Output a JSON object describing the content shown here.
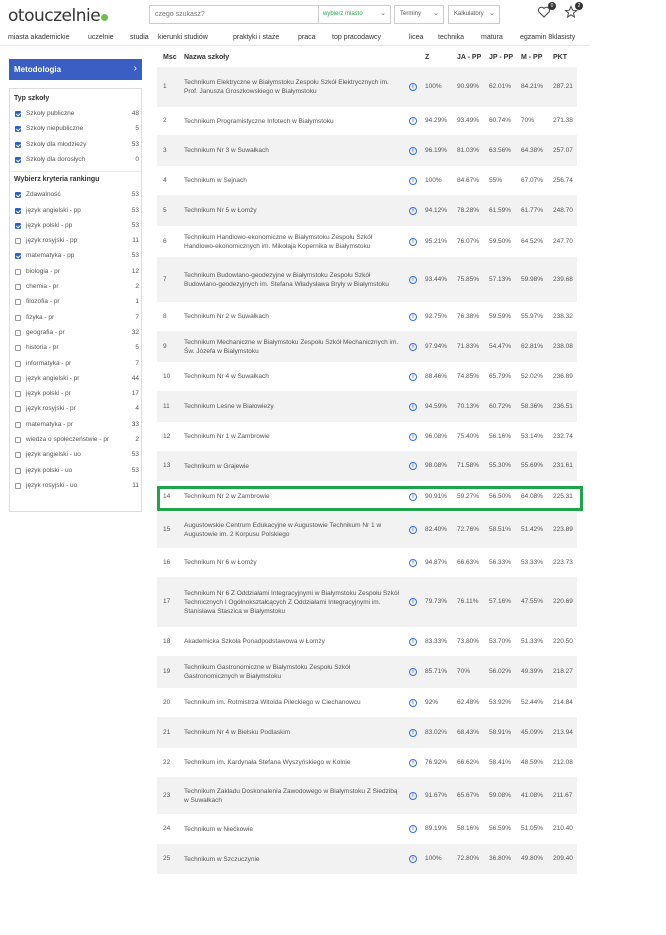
{
  "header": {
    "logo": "otouczelnie",
    "search_placeholder": "czego szukasz?",
    "city_label": "wybierz miasto",
    "terms_label": "Terminy",
    "calculators_label": "Kalkulatory",
    "hearts_count": "0",
    "stars_count": "2"
  },
  "nav": [
    "miasta akademickie",
    "uczelnie",
    "studia",
    "kierunki studiów",
    "praktyki i staże",
    "praca",
    "top pracodawcy",
    "licea",
    "technika",
    "matura",
    "egzamin 8klasisty"
  ],
  "sidebar": {
    "metodologia": "Metodologia",
    "type_title": "Typ szkoły",
    "types": [
      {
        "label": "Szkoły publiczne",
        "count": "48",
        "checked": true
      },
      {
        "label": "Szkoły niepubliczne",
        "count": "5",
        "checked": true
      },
      {
        "label": "Szkoły dla młodzieży",
        "count": "53",
        "checked": true
      },
      {
        "label": "Szkoły dla dorosłych",
        "count": "0",
        "checked": true
      }
    ],
    "criteria_title": "Wybierz kryteria rankingu",
    "criteria": [
      {
        "label": "Zdawalność",
        "count": "53",
        "checked": true
      },
      {
        "label": "język angielski - pp",
        "count": "53",
        "checked": true
      },
      {
        "label": "język polski - pp",
        "count": "53",
        "checked": true
      },
      {
        "label": "język rosyjski - pp",
        "count": "11",
        "checked": false
      },
      {
        "label": "matematyka - pp",
        "count": "53",
        "checked": true
      },
      {
        "label": "biologia - pr",
        "count": "12",
        "checked": false
      },
      {
        "label": "chemia - pr",
        "count": "2",
        "checked": false
      },
      {
        "label": "filozofia - pr",
        "count": "1",
        "checked": false
      },
      {
        "label": "fizyka - pr",
        "count": "7",
        "checked": false
      },
      {
        "label": "geografia - pr",
        "count": "32",
        "checked": false
      },
      {
        "label": "historia - pr",
        "count": "5",
        "checked": false
      },
      {
        "label": "informatyka - pr",
        "count": "7",
        "checked": false
      },
      {
        "label": "język angielski - pr",
        "count": "44",
        "checked": false
      },
      {
        "label": "język polski - pr",
        "count": "17",
        "checked": false
      },
      {
        "label": "język rosyjski - pr",
        "count": "4",
        "checked": false
      },
      {
        "label": "matematyka - pr",
        "count": "33",
        "checked": false
      },
      {
        "label": "wiedza o społeczeństwie - pr",
        "count": "2",
        "checked": false
      },
      {
        "label": "język angielski - uo",
        "count": "53",
        "checked": false
      },
      {
        "label": "język polski - uo",
        "count": "53",
        "checked": false
      },
      {
        "label": "język rosyjski - uo",
        "count": "11",
        "checked": false
      }
    ]
  },
  "table": {
    "headers": {
      "msc": "Msc",
      "name": "Nazwa szkoły",
      "z": "Z",
      "ja": "JA - PP",
      "jp": "JP - PP",
      "m": "M - PP",
      "pkt": "PKT"
    },
    "rows": [
      {
        "msc": "1",
        "name": "Technikum Elektryczne w Białymstoku Zespołu Szkół Elektrycznych im. Prof. Janusza Groszkowskiego w Białymstoku",
        "z": "100%",
        "ja": "90.99%",
        "jp": "62.01%",
        "m": "84.21%",
        "pkt": "287.21"
      },
      {
        "msc": "2",
        "name": "Technikum Programistyczne Infotech w Białymstoku",
        "z": "94.29%",
        "ja": "93.49%",
        "jp": "60.74%",
        "m": "70%",
        "pkt": "271.38"
      },
      {
        "msc": "3",
        "name": "Technikum Nr 3 w Suwałkach",
        "z": "96.19%",
        "ja": "81.03%",
        "jp": "63.56%",
        "m": "64.38%",
        "pkt": "257.07"
      },
      {
        "msc": "4",
        "name": "Technikum w Sejnach",
        "z": "100%",
        "ja": "84.67%",
        "jp": "55%",
        "m": "67.07%",
        "pkt": "256.74"
      },
      {
        "msc": "5",
        "name": "Technikum Nr 5 w Łomży",
        "z": "94.12%",
        "ja": "78.28%",
        "jp": "61.59%",
        "m": "61.77%",
        "pkt": "248.70"
      },
      {
        "msc": "6",
        "name": "Technikum Handlowo-ekonomiczne w Białymstoku Zespołu Szkół Handlowo-ekonomicznych im. Mikołaja Kopernika w Białymstoku",
        "z": "95.21%",
        "ja": "76.07%",
        "jp": "59.50%",
        "m": "64.52%",
        "pkt": "247.70"
      },
      {
        "msc": "7",
        "name": "Technikum Budowlano-geodezyjne w Białymstoku Zespołu Szkół Budowlano-geodezyjnych im. Stefana Władysława Bryły w Białymstoku",
        "z": "93.44%",
        "ja": "75.85%",
        "jp": "57.13%",
        "m": "59.98%",
        "pkt": "239.68"
      },
      {
        "msc": "8",
        "name": "Technikum Nr 2 w Suwałkach",
        "z": "92.75%",
        "ja": "76.38%",
        "jp": "59.59%",
        "m": "55.97%",
        "pkt": "238.32"
      },
      {
        "msc": "9",
        "name": "Technikum Mechaniczne w Białymstoku Zespołu Szkół Mechanicznych im. Św. Józefa w Białymstoku",
        "z": "97.94%",
        "ja": "71.83%",
        "jp": "54.47%",
        "m": "62.81%",
        "pkt": "238.08"
      },
      {
        "msc": "10",
        "name": "Technikum Nr 4 w Suwałkach",
        "z": "88.46%",
        "ja": "74.85%",
        "jp": "65.79%",
        "m": "52.02%",
        "pkt": "236.89"
      },
      {
        "msc": "11",
        "name": "Technikum Leśne w Białowieży",
        "z": "94.59%",
        "ja": "70.13%",
        "jp": "60.72%",
        "m": "58.36%",
        "pkt": "236.51"
      },
      {
        "msc": "12",
        "name": "Technikum Nr 1 w Zambrowie",
        "z": "96.08%",
        "ja": "75.40%",
        "jp": "56.16%",
        "m": "53.14%",
        "pkt": "232.74"
      },
      {
        "msc": "13",
        "name": "Technikum w Grajewie",
        "z": "98.08%",
        "ja": "71.58%",
        "jp": "55.30%",
        "m": "55.69%",
        "pkt": "231.61"
      },
      {
        "msc": "14",
        "name": "Technikum Nr 2 w Zambrowie",
        "z": "90.91%",
        "ja": "59.27%",
        "jp": "56.50%",
        "m": "64.08%",
        "pkt": "225.31"
      },
      {
        "msc": "15",
        "name": "Augustowskie Centrum Edukacyjne w Augustowie Technikum Nr 1 w Augustowie im. 2 Korpusu Polskiego",
        "z": "82.40%",
        "ja": "72.76%",
        "jp": "58.51%",
        "m": "51.42%",
        "pkt": "223.89"
      },
      {
        "msc": "16",
        "name": "Technikum Nr 6 w Łomży",
        "z": "94.87%",
        "ja": "66.63%",
        "jp": "56.33%",
        "m": "53.33%",
        "pkt": "223.73"
      },
      {
        "msc": "17",
        "name": "Technikum Nr 6 Z Oddziałami Integracyjnymi w Białymstoku Zespołu Szkół Technicznych I Ogólnokształcących Z Oddziałami Integracyjnymi im. Stanisława Staszica w Białymstoku",
        "z": "79.73%",
        "ja": "76.11%",
        "jp": "57.16%",
        "m": "47.55%",
        "pkt": "220.69"
      },
      {
        "msc": "18",
        "name": "Akademicka Szkoła Ponadpodstawowa w Łomży",
        "z": "83.33%",
        "ja": "73.80%",
        "jp": "53.70%",
        "m": "51.33%",
        "pkt": "220.50"
      },
      {
        "msc": "19",
        "name": "Technikum Gastronomiczne w Białymstoku Zespołu Szkół Gastronomicznych w Białymstoku",
        "z": "85.71%",
        "ja": "70%",
        "jp": "56.02%",
        "m": "49.39%",
        "pkt": "218.27"
      },
      {
        "msc": "20",
        "name": "Technikum im. Rotmistrza Witolda Pileckiego w Ciechanowcu",
        "z": "92%",
        "ja": "62.48%",
        "jp": "53.92%",
        "m": "52.44%",
        "pkt": "214.84"
      },
      {
        "msc": "21",
        "name": "Technikum Nr 4 w Bielsku Podlaskim",
        "z": "83.02%",
        "ja": "68.43%",
        "jp": "58.91%",
        "m": "45.09%",
        "pkt": "213.94"
      },
      {
        "msc": "22",
        "name": "Technikum im. Kardynała Stefana Wyszyńskiego w Kolnie",
        "z": "76.92%",
        "ja": "66.62%",
        "jp": "58.41%",
        "m": "48.59%",
        "pkt": "212.08"
      },
      {
        "msc": "23",
        "name": "Technikum Zakładu Doskonalenia Zawodowego w Białymstoku Z Siedzibą w Suwałkach",
        "z": "91.67%",
        "ja": "65.67%",
        "jp": "59.08%",
        "m": "41.08%",
        "pkt": "211.67"
      },
      {
        "msc": "24",
        "name": "Technikum w Niećkowie",
        "z": "89.19%",
        "ja": "58.16%",
        "jp": "56.59%",
        "m": "51.05%",
        "pkt": "210.40"
      },
      {
        "msc": "25",
        "name": "Technikum w Szczuczynie",
        "z": "100%",
        "ja": "72.80%",
        "jp": "36.80%",
        "m": "49.80%",
        "pkt": "209.40"
      }
    ]
  },
  "colors": {
    "accent_blue": "#3a5ec4",
    "highlight_green": "#1ea54a",
    "brand_green": "#6cc04a"
  }
}
